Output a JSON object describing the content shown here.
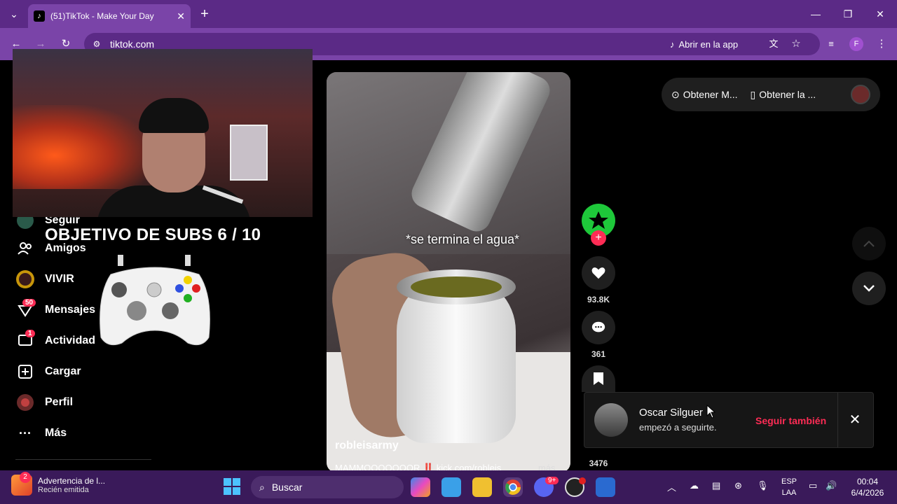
{
  "browser": {
    "tab_title": "(51)TikTok - Make Your Day",
    "url": "tiktok.com",
    "open_in_app": "Abrir en la app",
    "profile_initial": "F"
  },
  "stream_overlay": {
    "objective_text": "OBJETIVO DE SUBS 6 / 10"
  },
  "sidebar": {
    "items": [
      {
        "label": "Seguir",
        "icon": "following-icon"
      },
      {
        "label": "Amigos",
        "icon": "friends-icon"
      },
      {
        "label": "VIVIR",
        "icon": "live-icon"
      },
      {
        "label": "Mensajes",
        "icon": "messages-icon",
        "badge": "50"
      },
      {
        "label": "Actividad",
        "icon": "activity-icon",
        "badge": "1"
      },
      {
        "label": "Cargar",
        "icon": "upload-icon"
      },
      {
        "label": "Perfil",
        "icon": "profile-icon"
      },
      {
        "label": "Más",
        "icon": "more-icon"
      }
    ]
  },
  "video": {
    "caption_overlay": "*se termina el agua*",
    "author": "robleisarmy",
    "description": "MAMMOOOOOOOR ‼️ kick.com/robleis",
    "more_label": "más"
  },
  "actions": {
    "likes": "93.8K",
    "comments": "361",
    "saves": "3476"
  },
  "top_right": {
    "get_m": "Obtener M...",
    "get_app": "Obtener la ..."
  },
  "notification": {
    "name": "Oscar Silguer",
    "text": "empezó a seguirte.",
    "follow_back": "Seguir también"
  },
  "taskbar": {
    "warning_title": "Advertencia de l...",
    "warning_sub": "Recién emitida",
    "warning_badge": "2",
    "search_placeholder": "Buscar",
    "discord_badge": "9+",
    "lang_1": "ESP",
    "lang_2": "LAA",
    "time": "00:04",
    "date": "6/4/2026"
  },
  "colors": {
    "accent": "#fe2c55",
    "titlebar": "#5b2a86",
    "addressbar": "#7a44a8",
    "taskbar": "#3a1a5a"
  }
}
